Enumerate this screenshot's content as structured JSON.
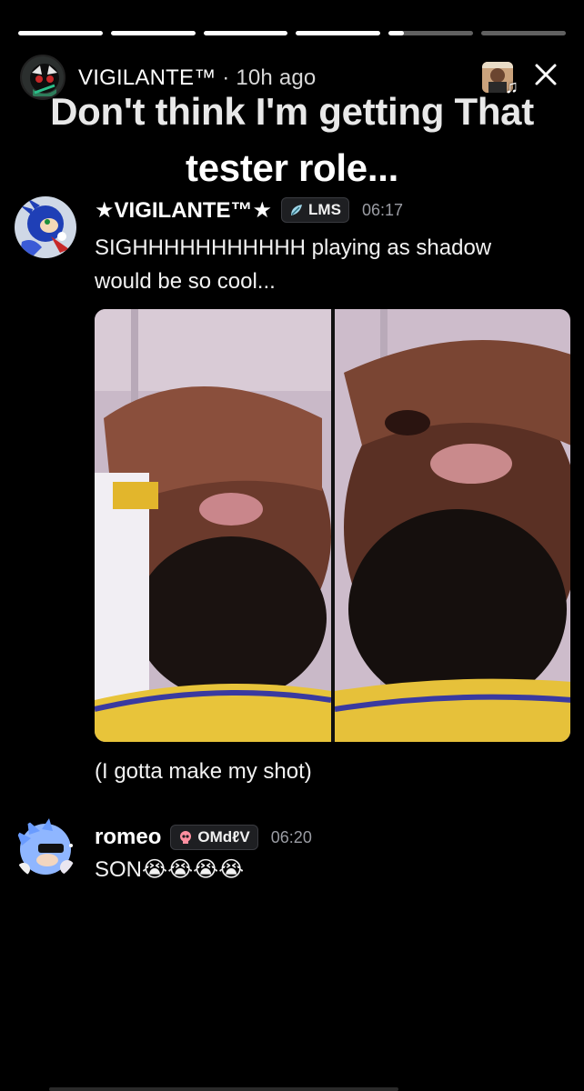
{
  "story": {
    "progress": [
      1,
      1,
      1,
      1,
      0.18,
      0
    ],
    "username": "VIGILANTE™",
    "separator": " · ",
    "time_ago": "10h ago",
    "caption_line1": "Don't think I'm getting That",
    "caption_line2": "tester role..."
  },
  "messages": [
    {
      "username": "★VIGILANTE™★",
      "tag": "LMS",
      "tag_icon": "leaf-icon",
      "time": "06:17",
      "line1": "SIGHHHHHHHHHHH playing as shadow",
      "line2": "would be so cool...",
      "after_image": "(I gotta make my shot)"
    },
    {
      "username": "romeo",
      "tag": "OMdℓV",
      "tag_icon": "skull-icon",
      "time": "06:20",
      "text": "SON",
      "emoji": [
        "😭",
        "😭",
        "😭",
        "😭"
      ]
    }
  ],
  "colors": {
    "background": "#000000",
    "timestamp": "#9a9ca3",
    "tag_bg": "#1e1f22"
  }
}
